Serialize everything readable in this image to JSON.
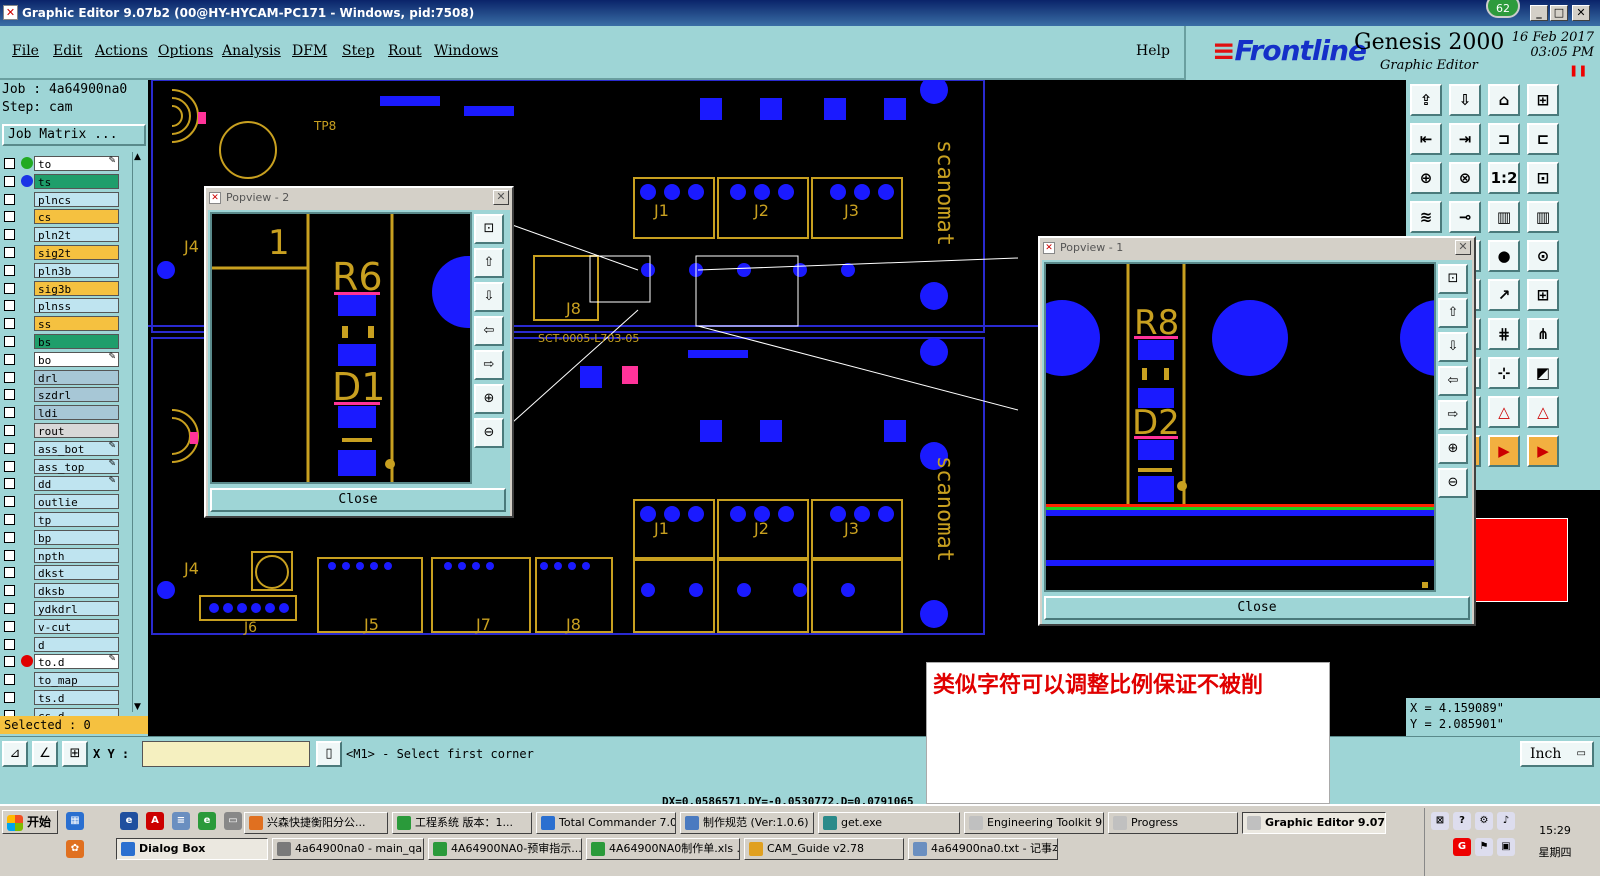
{
  "window": {
    "title": "Graphic Editor 9.07b2 (00@HY-HYCAM-PC171 - Windows, pid:7508)",
    "notify_badge": "62"
  },
  "menu": {
    "items": [
      "File",
      "Edit",
      "Actions",
      "Options",
      "Analysis",
      "DFM",
      "Step",
      "Rout",
      "Windows"
    ],
    "help": "Help"
  },
  "brand": {
    "logo": "Frontline",
    "product": "Genesis 2000",
    "subtitle": "Graphic Editor",
    "date": "16 Feb 2017",
    "time": "03:05 PM"
  },
  "job": {
    "job_line": "Job : 4a64900na0",
    "step_line": "Step: cam",
    "matrix_button": "Job Matrix ..."
  },
  "layers": [
    {
      "name": "to",
      "bg": "#ffffff",
      "dot": "#22aa22",
      "pen": true
    },
    {
      "name": "ts",
      "bg": "#1f9e6b",
      "dot": "#1a33e6",
      "pen": false
    },
    {
      "name": "plncs",
      "bg": "#bfe4f0",
      "dot": "",
      "pen": false
    },
    {
      "name": "cs",
      "bg": "#f5c140",
      "dot": "",
      "pen": false
    },
    {
      "name": "pln2t",
      "bg": "#bfe4f0",
      "dot": "",
      "pen": false
    },
    {
      "name": "sig2t",
      "bg": "#f5c140",
      "dot": "",
      "pen": false
    },
    {
      "name": "pln3b",
      "bg": "#bfe4f0",
      "dot": "",
      "pen": false
    },
    {
      "name": "sig3b",
      "bg": "#f5c140",
      "dot": "",
      "pen": false
    },
    {
      "name": "plnss",
      "bg": "#bfe4f0",
      "dot": "",
      "pen": false
    },
    {
      "name": "ss",
      "bg": "#f5c140",
      "dot": "",
      "pen": false
    },
    {
      "name": "bs",
      "bg": "#1f9e6b",
      "dot": "",
      "pen": false
    },
    {
      "name": "bo",
      "bg": "#ffffff",
      "dot": "",
      "pen": true
    },
    {
      "name": "drl",
      "bg": "#a7c7d6",
      "dot": "",
      "pen": false
    },
    {
      "name": "szdrl",
      "bg": "#a7c7d6",
      "dot": "",
      "pen": false
    },
    {
      "name": "ldi",
      "bg": "#a7c7d6",
      "dot": "",
      "pen": false
    },
    {
      "name": "rout",
      "bg": "#d8d8d8",
      "dot": "",
      "pen": false
    },
    {
      "name": "ass_bot",
      "bg": "#bfe4f0",
      "dot": "",
      "pen": true
    },
    {
      "name": "ass_top",
      "bg": "#bfe4f0",
      "dot": "",
      "pen": true
    },
    {
      "name": "dd",
      "bg": "#bfe4f0",
      "dot": "",
      "pen": true
    },
    {
      "name": "outlie",
      "bg": "#bfe4f0",
      "dot": "",
      "pen": false
    },
    {
      "name": "tp",
      "bg": "#bfe4f0",
      "dot": "",
      "pen": false
    },
    {
      "name": "bp",
      "bg": "#bfe4f0",
      "dot": "",
      "pen": false
    },
    {
      "name": "npth",
      "bg": "#bfe4f0",
      "dot": "",
      "pen": false
    },
    {
      "name": "dkst",
      "bg": "#bfe4f0",
      "dot": "",
      "pen": false
    },
    {
      "name": "dksb",
      "bg": "#bfe4f0",
      "dot": "",
      "pen": false
    },
    {
      "name": "ydkdrl",
      "bg": "#bfe4f0",
      "dot": "",
      "pen": false
    },
    {
      "name": "v-cut",
      "bg": "#bfe4f0",
      "dot": "",
      "pen": false
    },
    {
      "name": "d",
      "bg": "#bfe4f0",
      "dot": "",
      "pen": false
    },
    {
      "name": "to.d",
      "bg": "#ffffff",
      "dot": "#e00000",
      "pen": true
    },
    {
      "name": "to_map",
      "bg": "#bfe4f0",
      "dot": "",
      "pen": false
    },
    {
      "name": "ts.d",
      "bg": "#bfe4f0",
      "dot": "",
      "pen": false
    },
    {
      "name": "cs.d",
      "bg": "#bfe4f0",
      "dot": "",
      "pen": false
    }
  ],
  "selected": "Selected : 0",
  "coords": {
    "x": "X = 4.159089\"",
    "y": "Y = 2.085901\""
  },
  "cmd": {
    "xy_label": "X Y :",
    "xy_value": "",
    "prompt": "<M1> - Select first corner",
    "units": "Inch"
  },
  "measure": "DX=0.0586571,DY=-0.0530772,D=0.0791065",
  "note": "类似字符可以调整比例保证不被削",
  "popview2": {
    "title": "Popview - 2",
    "close": "Close",
    "labels": {
      "one": "1",
      "ref_a": "R6",
      "ref_b": "D1"
    }
  },
  "popview1": {
    "title": "Popview - 1",
    "close": "Close",
    "labels": {
      "ref_a": "R8",
      "ref_b": "D2"
    }
  },
  "board": {
    "connectors": [
      "J1",
      "J2",
      "J3",
      "J4",
      "J5",
      "J6",
      "J7",
      "J8"
    ],
    "brand_text": "scanomat",
    "part_code": "SCT-0005-L703-05",
    "tp_label": "TP8"
  },
  "taskbar": {
    "start": "开始",
    "row1": [
      "兴森快捷衡阳分公...",
      "工程系统  版本：1...",
      "Total Commander 7.0...",
      "制作规范 (Ver:1.0.6)",
      "get.exe",
      "Engineering Toolkit 9....",
      "Progress",
      "Graphic Editor 9.07..."
    ],
    "row2": [
      "Dialog Box",
      "4a64900na0 - main_qa",
      "4A64900NA0-预审指示...",
      "4A64900NA0制作单.xls ...",
      "CAM_Guide v2.78",
      "4a64900na0.txt - 记事本"
    ],
    "clock_time": "15:29",
    "clock_day": "星期四"
  },
  "colors": {
    "panel": "#9ed5d6",
    "pad": "#1a1aff",
    "silk": "#c8a020",
    "highlight": "#ff3399"
  }
}
